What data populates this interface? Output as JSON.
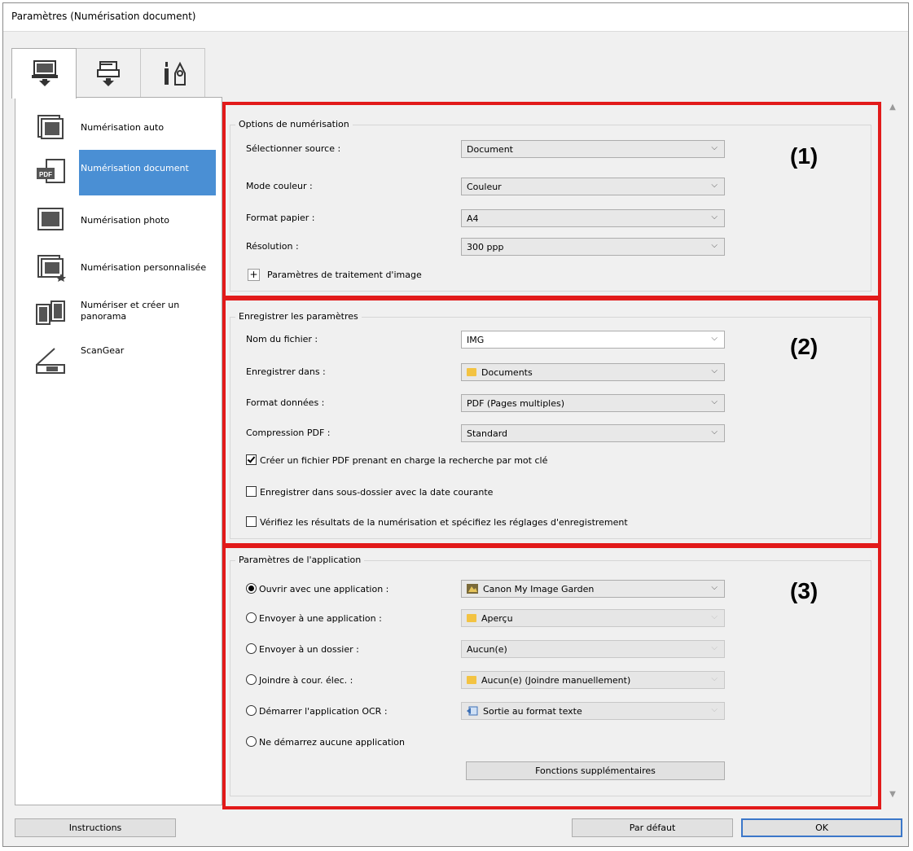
{
  "window": {
    "title": "Paramètres (Numérisation document)"
  },
  "tabs": [
    {
      "icon": "scan-from-computer-icon"
    },
    {
      "icon": "scan-from-panel-icon"
    },
    {
      "icon": "general-settings-tools-icon"
    }
  ],
  "sidebar": {
    "items": [
      {
        "label": "Numérisation auto",
        "icon": "auto-scan-icon",
        "selected": false
      },
      {
        "label": "Numérisation document",
        "icon": "pdf-document-icon",
        "selected": true
      },
      {
        "label": "Numérisation photo",
        "icon": "photo-scan-icon",
        "selected": false
      },
      {
        "label": "Numérisation personnalisée",
        "icon": "custom-scan-icon",
        "selected": false
      },
      {
        "label": "Numériser et créer un panorama",
        "icon": "panorama-icon",
        "selected": false
      },
      {
        "label": "ScanGear",
        "icon": "scangear-icon",
        "selected": false
      }
    ]
  },
  "scan_options": {
    "legend": "Options de numérisation",
    "marker": "(1)",
    "source_label": "Sélectionner source :",
    "source_value": "Document",
    "color_label": "Mode couleur :",
    "color_value": "Couleur",
    "paper_label": "Format papier :",
    "paper_value": "A4",
    "resolution_label": "Résolution :",
    "resolution_value": "300 ppp",
    "image_processing_label": "Paramètres de traitement d'image",
    "expand_symbol": "+"
  },
  "save_settings": {
    "legend": "Enregistrer les paramètres",
    "marker": "(2)",
    "filename_label": "Nom du fichier :",
    "filename_value": "IMG",
    "save_in_label": "Enregistrer dans :",
    "save_in_value": "Documents",
    "data_format_label": "Format données :",
    "data_format_value": "PDF (Pages multiples)",
    "pdf_compression_label": "Compression PDF :",
    "pdf_compression_value": "Standard",
    "checkbox_keyword_pdf": {
      "label": "Créer un fichier PDF prenant en charge la recherche par mot clé",
      "checked": true
    },
    "checkbox_subfolder_date": {
      "label": "Enregistrer dans sous-dossier avec la date courante",
      "checked": false
    },
    "checkbox_verify_results": {
      "label": "Vérifiez les résultats de la numérisation et spécifiez les réglages d'enregistrement",
      "checked": false
    }
  },
  "app_settings": {
    "legend": "Paramètres de l'application",
    "marker": "(3)",
    "open_with_label": "Ouvrir avec une application :",
    "open_with_value": "Canon My Image Garden",
    "send_to_app_label": "Envoyer à une application :",
    "send_to_app_value": "Aperçu",
    "send_to_folder_label": "Envoyer à un dossier :",
    "send_to_folder_value": "Aucun(e)",
    "attach_email_label": "Joindre à cour. élec. :",
    "attach_email_value": "Aucun(e) (Joindre manuellement)",
    "start_ocr_label": "Démarrer l'application OCR :",
    "start_ocr_value": "Sortie au format texte",
    "no_app_label": "Ne démarrez aucune application",
    "more_functions_label": "Fonctions supplémentaires",
    "selected_option": "open_with"
  },
  "footer": {
    "instructions_label": "Instructions",
    "defaults_label": "Par défaut",
    "ok_label": "OK"
  },
  "colors": {
    "highlight_red": "#e21a1a",
    "selection_blue": "#4a8fd4",
    "default_button_border": "#3b77c9"
  }
}
